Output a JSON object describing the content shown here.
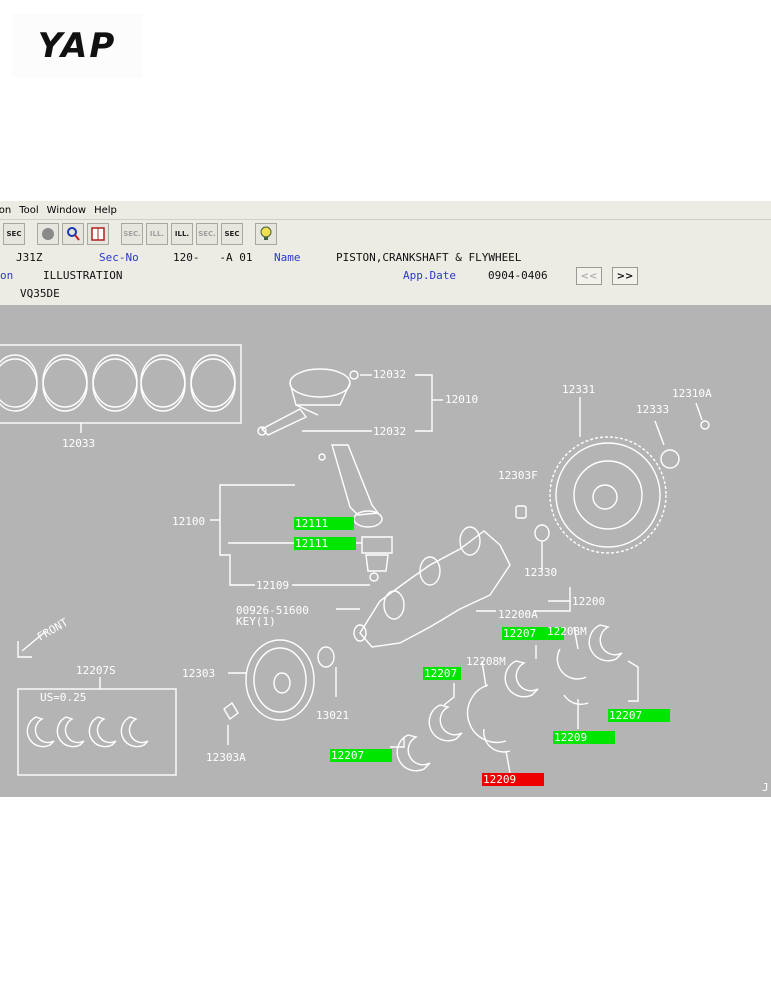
{
  "logo": {
    "text_main": "YAP"
  },
  "menu": [
    "ion",
    "Tool",
    "Window",
    "Help"
  ],
  "toolbar": {
    "buttons": [
      "SEC",
      "",
      "",
      "",
      "SEC.",
      "ILL.",
      "ILL.",
      "SEC.",
      "SEC",
      ""
    ]
  },
  "info": {
    "model": "J31Z",
    "secno_label": "Sec-No",
    "secno_value": "120-   -A 01",
    "name_label": "Name",
    "name_value": "PISTON,CRANKSHAFT & FLYWHEEL",
    "row2_label": "on",
    "row2_value": "ILLUSTRATION",
    "appdate_label": "App.Date",
    "appdate_value": "0904-0406",
    "prev": "<<",
    "next": ">>",
    "engine": "VQ35DE"
  },
  "diagram": {
    "labels": {
      "p12033": "12033",
      "p12032a": "12032",
      "p12032b": "12032",
      "p12010": "12010",
      "p12331": "12331",
      "p12310a": "12310A",
      "p12333": "12333",
      "p12303f": "12303F",
      "p12100": "12100",
      "p12109": "12109",
      "p12330": "12330",
      "p12200": "12200",
      "p12200a": "12200A",
      "p00926": "00926-51600",
      "key": "KEY(1)",
      "front": "FRONT",
      "p12207s": "12207S",
      "us": "US=0.25",
      "p12303": "12303",
      "p13021": "13021",
      "p12303a": "12303A",
      "p12208m_a": "12208M",
      "p12208m_b": "12208M",
      "corner": "J"
    },
    "highlights": {
      "h12111a": "12111",
      "h12111b": "12111",
      "h12207a": "12207",
      "h12207b": "12207",
      "h12207c": "12207",
      "h12207d": "12207",
      "h12209g": "12209",
      "h12209r": "12209"
    },
    "colors": {
      "green": "#00e600",
      "red": "#ee0000",
      "gray": "#b4b4b4"
    }
  }
}
